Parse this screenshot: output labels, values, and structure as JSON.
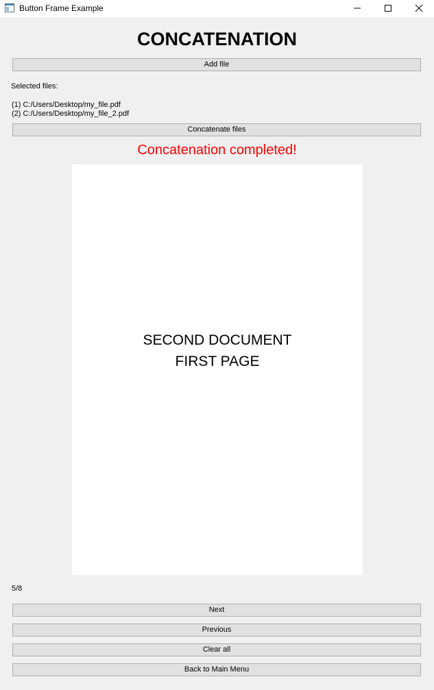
{
  "window": {
    "title": "Button Frame Example",
    "controls": {
      "minimize": "minimize-icon",
      "maximize": "maximize-icon",
      "close": "close-icon"
    }
  },
  "main": {
    "heading": "CONCATENATION",
    "add_file_label": "Add file",
    "selected_files_label": "Selected files:",
    "files": [
      "(1) C:/Users/Desktop/my_file.pdf",
      "(2) C:/Users/Desktop/my_file_2.pdf"
    ],
    "concatenate_label": "Concatenate files",
    "status": "Concatenation completed!",
    "status_color": "#ff0000",
    "preview": {
      "line1": "SECOND DOCUMENT",
      "line2": "FIRST PAGE"
    },
    "page_counter": "5/8",
    "next_label": "Next",
    "previous_label": "Previous",
    "clear_label": "Clear all",
    "back_label": "Back to Main Menu"
  }
}
